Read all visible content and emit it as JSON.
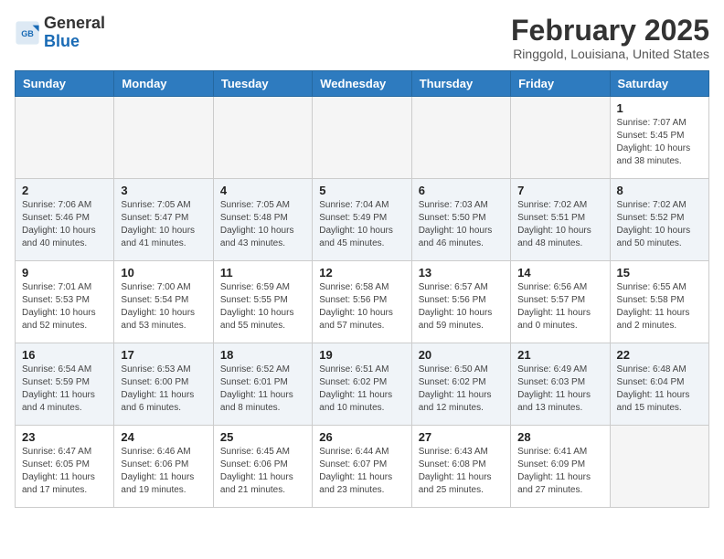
{
  "header": {
    "logo_general": "General",
    "logo_blue": "Blue",
    "month_title": "February 2025",
    "location": "Ringgold, Louisiana, United States"
  },
  "days_of_week": [
    "Sunday",
    "Monday",
    "Tuesday",
    "Wednesday",
    "Thursday",
    "Friday",
    "Saturday"
  ],
  "weeks": [
    [
      {
        "day": "",
        "info": ""
      },
      {
        "day": "",
        "info": ""
      },
      {
        "day": "",
        "info": ""
      },
      {
        "day": "",
        "info": ""
      },
      {
        "day": "",
        "info": ""
      },
      {
        "day": "",
        "info": ""
      },
      {
        "day": "1",
        "info": "Sunrise: 7:07 AM\nSunset: 5:45 PM\nDaylight: 10 hours\nand 38 minutes."
      }
    ],
    [
      {
        "day": "2",
        "info": "Sunrise: 7:06 AM\nSunset: 5:46 PM\nDaylight: 10 hours\nand 40 minutes."
      },
      {
        "day": "3",
        "info": "Sunrise: 7:05 AM\nSunset: 5:47 PM\nDaylight: 10 hours\nand 41 minutes."
      },
      {
        "day": "4",
        "info": "Sunrise: 7:05 AM\nSunset: 5:48 PM\nDaylight: 10 hours\nand 43 minutes."
      },
      {
        "day": "5",
        "info": "Sunrise: 7:04 AM\nSunset: 5:49 PM\nDaylight: 10 hours\nand 45 minutes."
      },
      {
        "day": "6",
        "info": "Sunrise: 7:03 AM\nSunset: 5:50 PM\nDaylight: 10 hours\nand 46 minutes."
      },
      {
        "day": "7",
        "info": "Sunrise: 7:02 AM\nSunset: 5:51 PM\nDaylight: 10 hours\nand 48 minutes."
      },
      {
        "day": "8",
        "info": "Sunrise: 7:02 AM\nSunset: 5:52 PM\nDaylight: 10 hours\nand 50 minutes."
      }
    ],
    [
      {
        "day": "9",
        "info": "Sunrise: 7:01 AM\nSunset: 5:53 PM\nDaylight: 10 hours\nand 52 minutes."
      },
      {
        "day": "10",
        "info": "Sunrise: 7:00 AM\nSunset: 5:54 PM\nDaylight: 10 hours\nand 53 minutes."
      },
      {
        "day": "11",
        "info": "Sunrise: 6:59 AM\nSunset: 5:55 PM\nDaylight: 10 hours\nand 55 minutes."
      },
      {
        "day": "12",
        "info": "Sunrise: 6:58 AM\nSunset: 5:56 PM\nDaylight: 10 hours\nand 57 minutes."
      },
      {
        "day": "13",
        "info": "Sunrise: 6:57 AM\nSunset: 5:56 PM\nDaylight: 10 hours\nand 59 minutes."
      },
      {
        "day": "14",
        "info": "Sunrise: 6:56 AM\nSunset: 5:57 PM\nDaylight: 11 hours\nand 0 minutes."
      },
      {
        "day": "15",
        "info": "Sunrise: 6:55 AM\nSunset: 5:58 PM\nDaylight: 11 hours\nand 2 minutes."
      }
    ],
    [
      {
        "day": "16",
        "info": "Sunrise: 6:54 AM\nSunset: 5:59 PM\nDaylight: 11 hours\nand 4 minutes."
      },
      {
        "day": "17",
        "info": "Sunrise: 6:53 AM\nSunset: 6:00 PM\nDaylight: 11 hours\nand 6 minutes."
      },
      {
        "day": "18",
        "info": "Sunrise: 6:52 AM\nSunset: 6:01 PM\nDaylight: 11 hours\nand 8 minutes."
      },
      {
        "day": "19",
        "info": "Sunrise: 6:51 AM\nSunset: 6:02 PM\nDaylight: 11 hours\nand 10 minutes."
      },
      {
        "day": "20",
        "info": "Sunrise: 6:50 AM\nSunset: 6:02 PM\nDaylight: 11 hours\nand 12 minutes."
      },
      {
        "day": "21",
        "info": "Sunrise: 6:49 AM\nSunset: 6:03 PM\nDaylight: 11 hours\nand 13 minutes."
      },
      {
        "day": "22",
        "info": "Sunrise: 6:48 AM\nSunset: 6:04 PM\nDaylight: 11 hours\nand 15 minutes."
      }
    ],
    [
      {
        "day": "23",
        "info": "Sunrise: 6:47 AM\nSunset: 6:05 PM\nDaylight: 11 hours\nand 17 minutes."
      },
      {
        "day": "24",
        "info": "Sunrise: 6:46 AM\nSunset: 6:06 PM\nDaylight: 11 hours\nand 19 minutes."
      },
      {
        "day": "25",
        "info": "Sunrise: 6:45 AM\nSunset: 6:06 PM\nDaylight: 11 hours\nand 21 minutes."
      },
      {
        "day": "26",
        "info": "Sunrise: 6:44 AM\nSunset: 6:07 PM\nDaylight: 11 hours\nand 23 minutes."
      },
      {
        "day": "27",
        "info": "Sunrise: 6:43 AM\nSunset: 6:08 PM\nDaylight: 11 hours\nand 25 minutes."
      },
      {
        "day": "28",
        "info": "Sunrise: 6:41 AM\nSunset: 6:09 PM\nDaylight: 11 hours\nand 27 minutes."
      },
      {
        "day": "",
        "info": ""
      }
    ]
  ]
}
